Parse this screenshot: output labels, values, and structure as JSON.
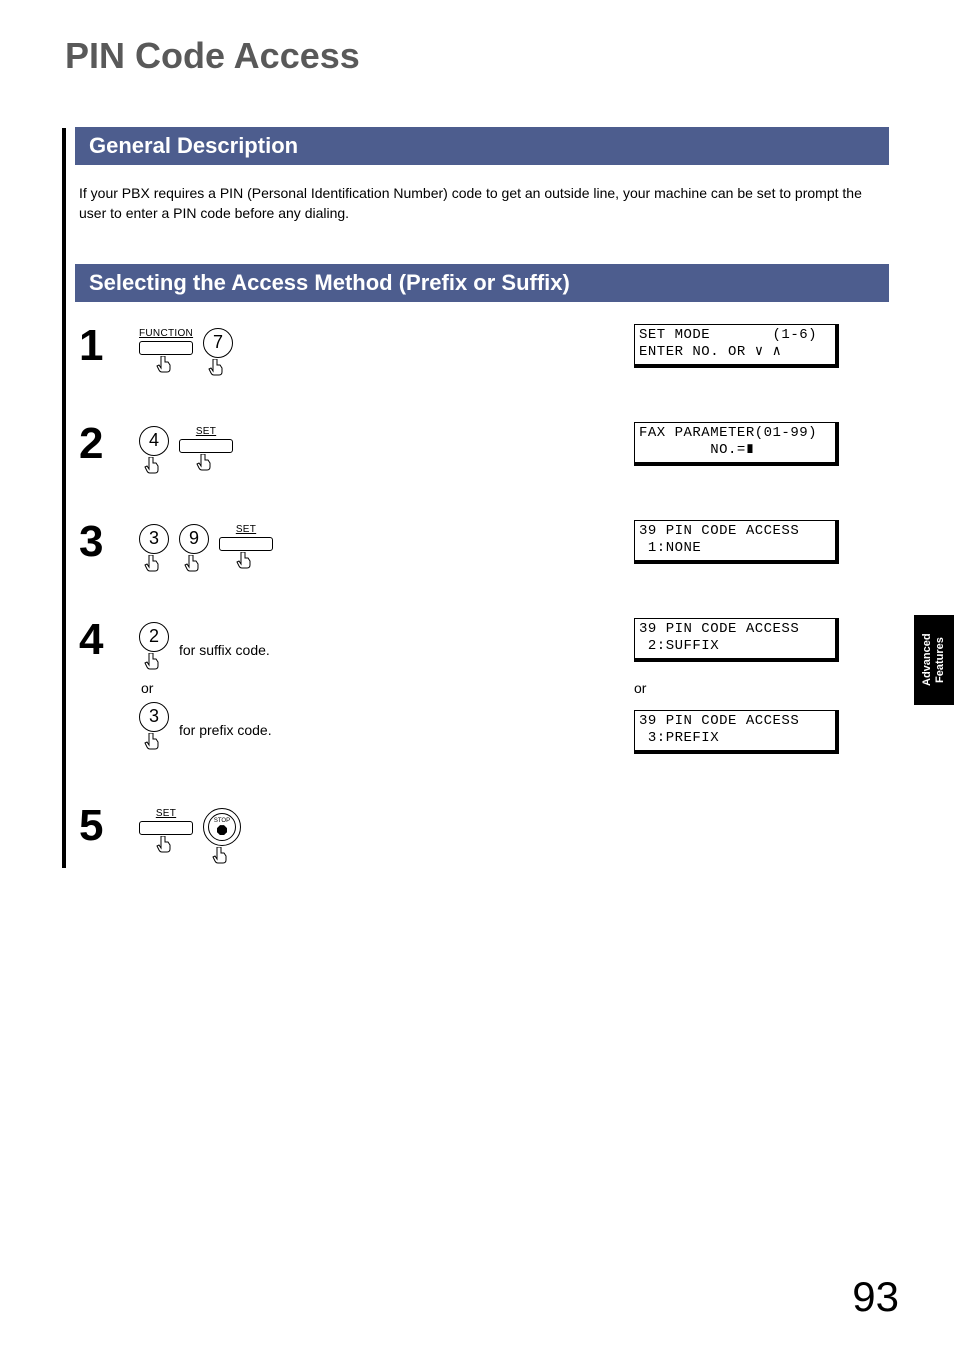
{
  "page_title": "PIN Code Access",
  "section1": {
    "title": "General Description",
    "body": "If your PBX requires a PIN (Personal Identification Number) code to get an outside line, your machine can be set to prompt the user to enter a PIN code before any dialing."
  },
  "section2": {
    "title": "Selecting the Access Method (Prefix or Suffix)"
  },
  "steps": {
    "s1": {
      "num": "1",
      "function_label": "FUNCTION",
      "key1": "7",
      "lcd": "SET MODE       (1-6)\nENTER NO. OR ∨ ∧"
    },
    "s2": {
      "num": "2",
      "key1": "4",
      "set_label": "SET",
      "lcd": "FAX PARAMETER(01-99)\n        NO.=∎"
    },
    "s3": {
      "num": "3",
      "key1": "3",
      "key2": "9",
      "set_label": "SET",
      "lcd": "39 PIN CODE ACCESS\n 1:NONE"
    },
    "s4": {
      "num": "4",
      "key_suffix": "2",
      "after_suffix": "for suffix code.",
      "or": "or",
      "key_prefix": "3",
      "after_prefix": "for prefix code.",
      "lcd_suffix": "39 PIN CODE ACCESS\n 2:SUFFIX",
      "or_right": "or",
      "lcd_prefix": "39 PIN CODE ACCESS\n 3:PREFIX"
    },
    "s5": {
      "num": "5",
      "set_label": "SET",
      "stop_label": "STOP"
    }
  },
  "side_tab": "Advanced\nFeatures",
  "page_number": "93"
}
